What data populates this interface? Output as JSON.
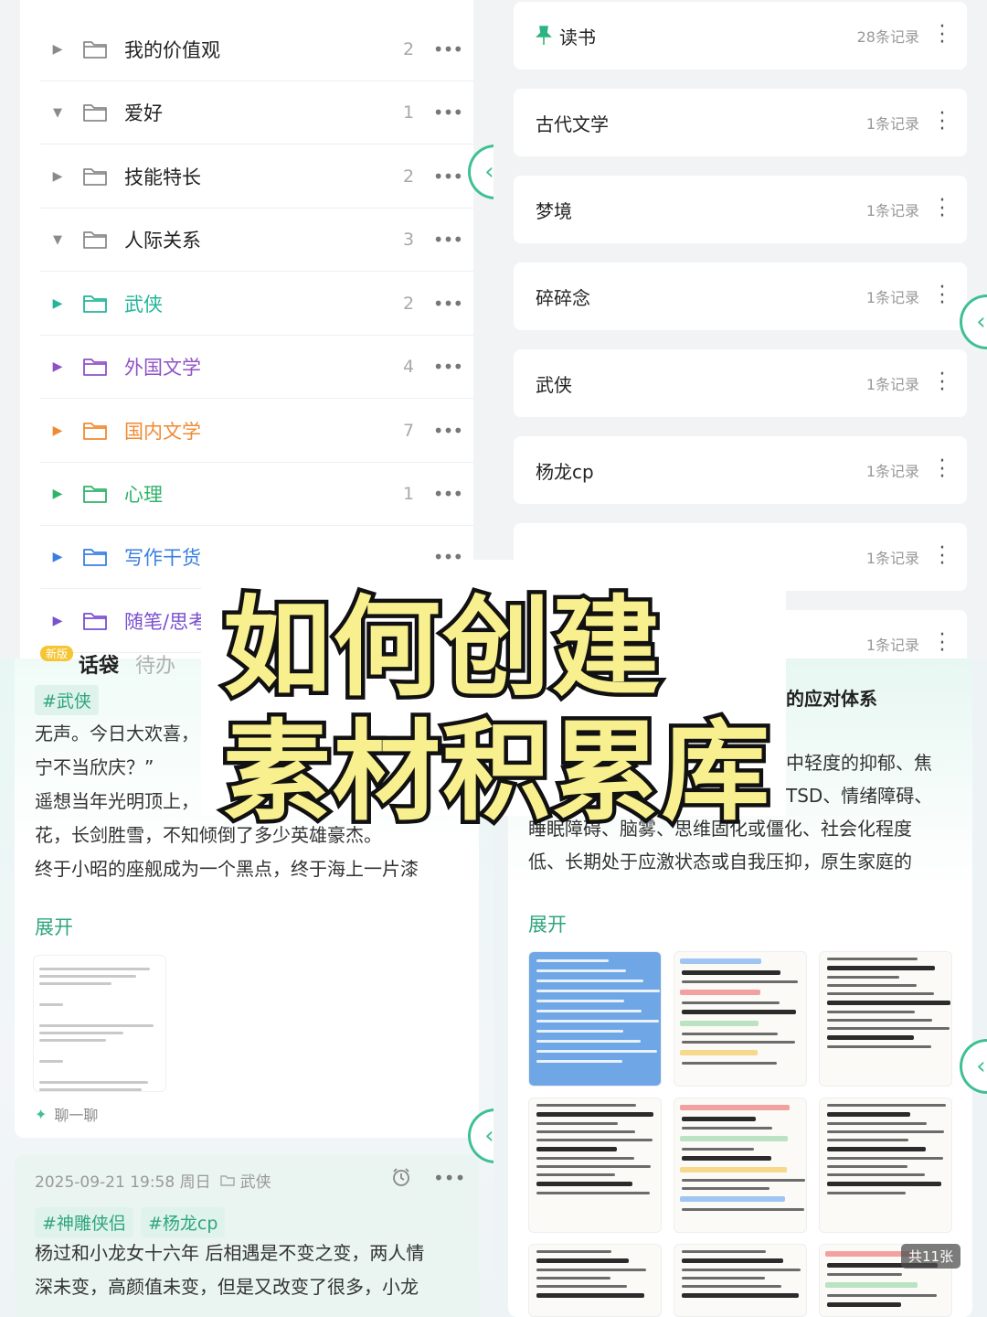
{
  "tree": {
    "items": [
      {
        "name": "我的价值观",
        "count": "2",
        "expanded": false,
        "color": "#8a8a8a",
        "text_color": "#222222"
      },
      {
        "name": "爱好",
        "count": "1",
        "expanded": true,
        "color": "#8a8a8a",
        "text_color": "#222222"
      },
      {
        "name": "技能特长",
        "count": "2",
        "expanded": false,
        "color": "#8a8a8a",
        "text_color": "#222222"
      },
      {
        "name": "人际关系",
        "count": "3",
        "expanded": true,
        "color": "#8a8a8a",
        "text_color": "#222222"
      },
      {
        "name": "武侠",
        "count": "2",
        "expanded": false,
        "color": "#23b59a",
        "text_color": "#23b59a"
      },
      {
        "name": "外国文学",
        "count": "4",
        "expanded": false,
        "color": "#8f52c6",
        "text_color": "#8f52c6"
      },
      {
        "name": "国内文学",
        "count": "7",
        "expanded": false,
        "color": "#f08a32",
        "text_color": "#f08a32"
      },
      {
        "name": "心理",
        "count": "1",
        "expanded": false,
        "color": "#2fb36a",
        "text_color": "#2fb36a"
      },
      {
        "name": "写作干货",
        "count": "",
        "expanded": false,
        "color": "#3a7fe0",
        "text_color": "#3a7fe0"
      },
      {
        "name": "随笔/思考",
        "count": "",
        "expanded": false,
        "color": "#7a4fd0",
        "text_color": "#7a4fd0"
      }
    ],
    "more_glyph": "•••"
  },
  "categories": {
    "items": [
      {
        "name": "读书",
        "records": "28条记录",
        "pinned": true
      },
      {
        "name": "古代文学",
        "records": "1条记录",
        "pinned": false
      },
      {
        "name": "梦境",
        "records": "1条记录",
        "pinned": false
      },
      {
        "name": "碎碎念",
        "records": "1条记录",
        "pinned": false
      },
      {
        "name": "武侠",
        "records": "1条记录",
        "pinned": false
      },
      {
        "name": "杨龙cp",
        "records": "1条记录",
        "pinned": false
      },
      {
        "name": "",
        "records": "1条记录",
        "pinned": false
      },
      {
        "name": "",
        "records": "1条记录",
        "pinned": false
      }
    ]
  },
  "note_left": {
    "new_badge": "新版",
    "tab_active": "话袋",
    "tab_inactive": "待办",
    "tag": "#武侠",
    "lines": [
      "无声。今日大欢喜，",
      "宁不当欣庆？”",
      "遥想当年光明顶上，",
      "花，长剑胜雪，不知倾倒了多少英雄豪杰。",
      "终于小昭的座舰成为一个黑点，终于海上一片漆"
    ],
    "expand": "展开",
    "chat_hint": "聊一聊"
  },
  "note_left2": {
    "date": "2025-09-21 19:58 周日",
    "folder": "武侠",
    "tags": [
      "#神雕侠侣",
      "#杨龙cp"
    ],
    "lines": [
      "杨过和小龙女十六年  后相遇是不变之变，两人情",
      "深未变，高颜值未变，但是又改变了很多，小龙"
    ]
  },
  "note_right": {
    "heading": "的应对体系",
    "lines": [
      "中轻度的抑郁、焦",
      "TSD、情绪障碍、",
      "睡眠障碍、脑雾、思维固化或僵化、社会化程度",
      "低、长期处于应激状态或自我压抑，原生家庭的"
    ],
    "expand": "展开",
    "image_count": "共11张"
  },
  "overlay": {
    "line1": "如何创建",
    "line2": "素材积累库"
  },
  "colors": {
    "accent": "#3fbf95",
    "tag_bg": "#dff3ec",
    "title_fill": "#f8f08f",
    "title_stroke": "#111111"
  }
}
